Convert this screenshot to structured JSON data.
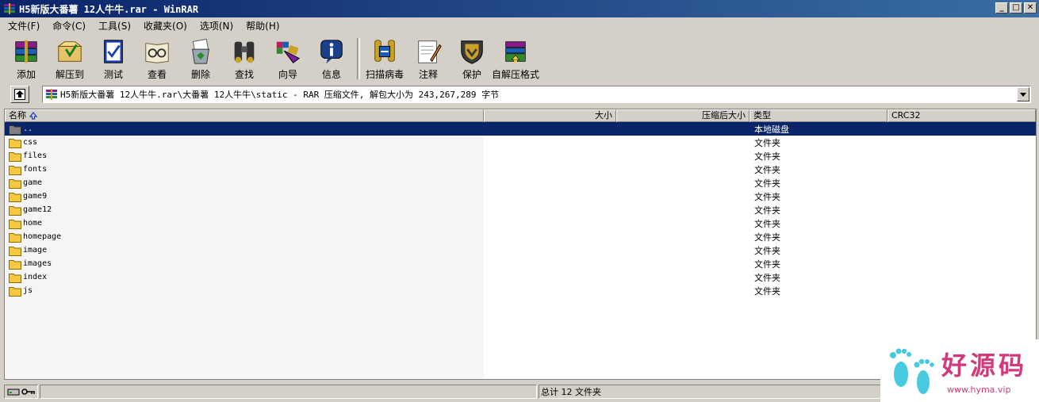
{
  "window": {
    "title": "H5新版大番薯 12人牛牛.rar - WinRAR",
    "minimize": "_",
    "maximize": "□",
    "close": "✕"
  },
  "menu": [
    "文件(F)",
    "命令(C)",
    "工具(S)",
    "收藏夹(O)",
    "选项(N)",
    "帮助(H)"
  ],
  "toolbar": [
    {
      "label": "添加",
      "icon": "add-books-icon"
    },
    {
      "label": "解压到",
      "icon": "extract-to-icon"
    },
    {
      "label": "测试",
      "icon": "test-icon"
    },
    {
      "label": "查看",
      "icon": "view-glasses-icon"
    },
    {
      "label": "删除",
      "icon": "delete-recycle-icon"
    },
    {
      "label": "查找",
      "icon": "find-binoculars-icon"
    },
    {
      "label": "向导",
      "icon": "wizard-icon"
    },
    {
      "label": "信息",
      "icon": "info-icon"
    },
    {
      "label": "扫描病毒",
      "icon": "virus-scan-icon"
    },
    {
      "label": "注释",
      "icon": "comment-icon"
    },
    {
      "label": "保护",
      "icon": "protect-shield-icon"
    },
    {
      "label": "自解压格式",
      "icon": "sfx-icon"
    }
  ],
  "path": {
    "text": "H5新版大番薯 12人牛牛.rar\\大番薯 12人牛牛\\static - RAR 压缩文件, 解包大小为 243,267,289 字节"
  },
  "columns": {
    "name": "名称",
    "size": "大小",
    "packed": "压缩后大小",
    "type": "类型",
    "crc": "CRC32"
  },
  "files": [
    {
      "name": "..",
      "type": "本地磁盘",
      "selected": true
    },
    {
      "name": "css",
      "type": "文件夹"
    },
    {
      "name": "files",
      "type": "文件夹"
    },
    {
      "name": "fonts",
      "type": "文件夹"
    },
    {
      "name": "game",
      "type": "文件夹"
    },
    {
      "name": "game9",
      "type": "文件夹"
    },
    {
      "name": "game12",
      "type": "文件夹"
    },
    {
      "name": "home",
      "type": "文件夹"
    },
    {
      "name": "homepage",
      "type": "文件夹"
    },
    {
      "name": "image",
      "type": "文件夹"
    },
    {
      "name": "images",
      "type": "文件夹"
    },
    {
      "name": "index",
      "type": "文件夹"
    },
    {
      "name": "js",
      "type": "文件夹"
    }
  ],
  "status": {
    "summary": "总计 12 文件夹"
  },
  "watermark": {
    "text": "好源码",
    "url": "www.hyma.vip"
  },
  "colors": {
    "titlebar_start": "#0a246a",
    "titlebar_end": "#3a6ea5",
    "selection": "#0a246a",
    "folder": "#f5c842",
    "watermark": "#d03a7c"
  }
}
